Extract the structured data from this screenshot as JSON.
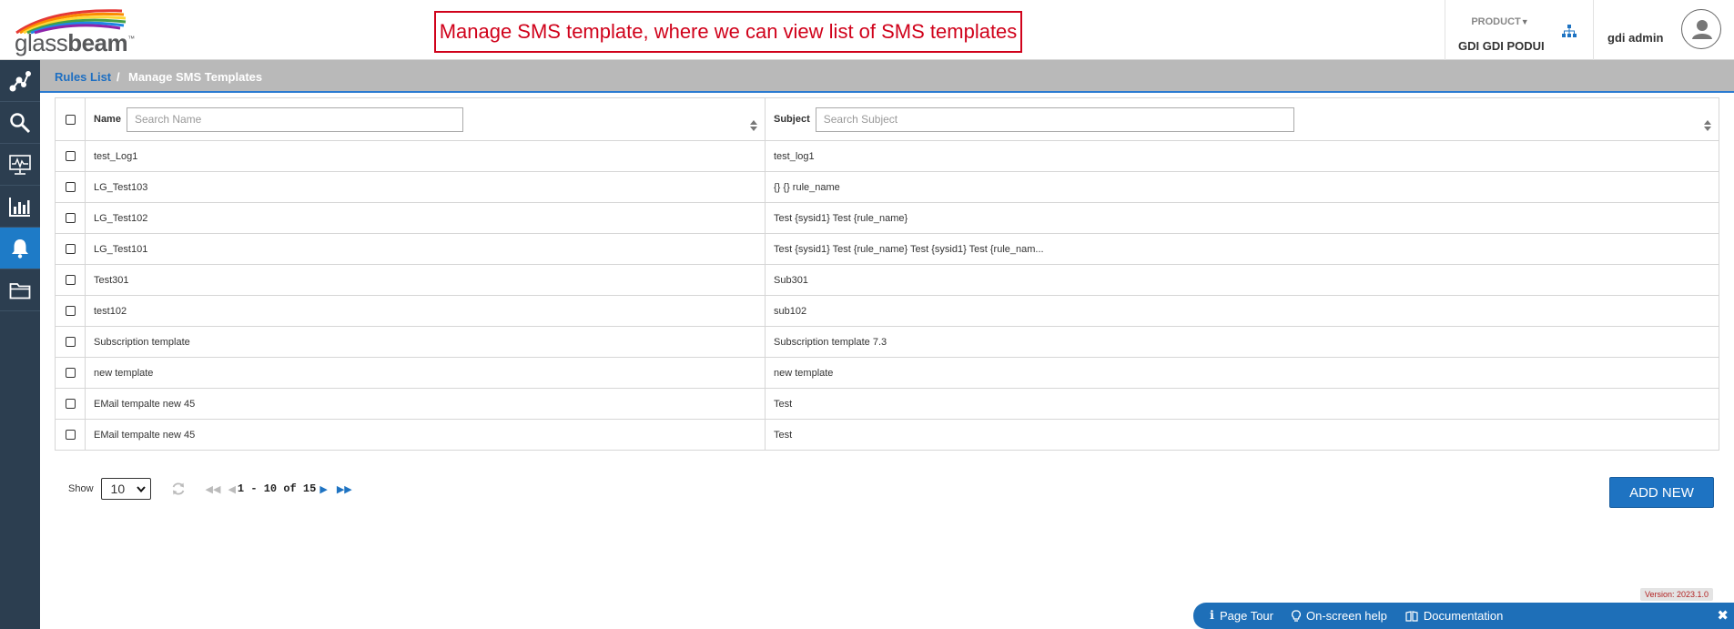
{
  "brand": {
    "name_light": "glass",
    "name_bold": "beam",
    "tm": "™"
  },
  "annotation": "Manage SMS template, where we can view list of SMS templates",
  "header": {
    "product_label": "PRODUCT",
    "product_value": "GDI GDI PODUI",
    "user_name": "gdi admin"
  },
  "sidebar": {
    "items": [
      {
        "icon": "analytics-nodes-icon"
      },
      {
        "icon": "search-icon"
      },
      {
        "icon": "monitor-chart-icon"
      },
      {
        "icon": "bar-chart-icon"
      },
      {
        "icon": "bell-icon",
        "active": true
      },
      {
        "icon": "folder-icon"
      }
    ]
  },
  "breadcrumb": {
    "parent": "Rules List",
    "separator": "/",
    "current": "Manage SMS Templates"
  },
  "table": {
    "columns": {
      "name": {
        "label": "Name",
        "placeholder": "Search Name"
      },
      "subject": {
        "label": "Subject",
        "placeholder": "Search Subject"
      }
    },
    "rows": [
      {
        "name": "test_Log1",
        "subject": "test_log1"
      },
      {
        "name": "LG_Test103",
        "subject": "{} {} rule_name"
      },
      {
        "name": "LG_Test102",
        "subject": "Test {sysid1} Test {rule_name}"
      },
      {
        "name": "LG_Test101",
        "subject": "Test {sysid1} Test {rule_name} Test {sysid1} Test {rule_nam..."
      },
      {
        "name": "Test301",
        "subject": "Sub301"
      },
      {
        "name": "test102",
        "subject": "sub102"
      },
      {
        "name": "Subscription template",
        "subject": "Subscription template 7.3"
      },
      {
        "name": "new template",
        "subject": "new template"
      },
      {
        "name": "EMail tempalte new 45",
        "subject": "Test"
      },
      {
        "name": "EMail tempalte new 45",
        "subject": "Test"
      }
    ]
  },
  "pager": {
    "show_label": "Show",
    "page_size": "10",
    "range": "1 - 10 of 15"
  },
  "actions": {
    "add_new": "ADD NEW"
  },
  "footer": {
    "version": "Version: 2023.1.0",
    "page_tour": "Page Tour",
    "onscreen_help": "On-screen help",
    "documentation": "Documentation"
  },
  "colors": {
    "sidebar": "#2c3e50",
    "accent": "#1e73c2",
    "annotation": "#d0021b",
    "crumb_bar": "#b9b9b9"
  }
}
